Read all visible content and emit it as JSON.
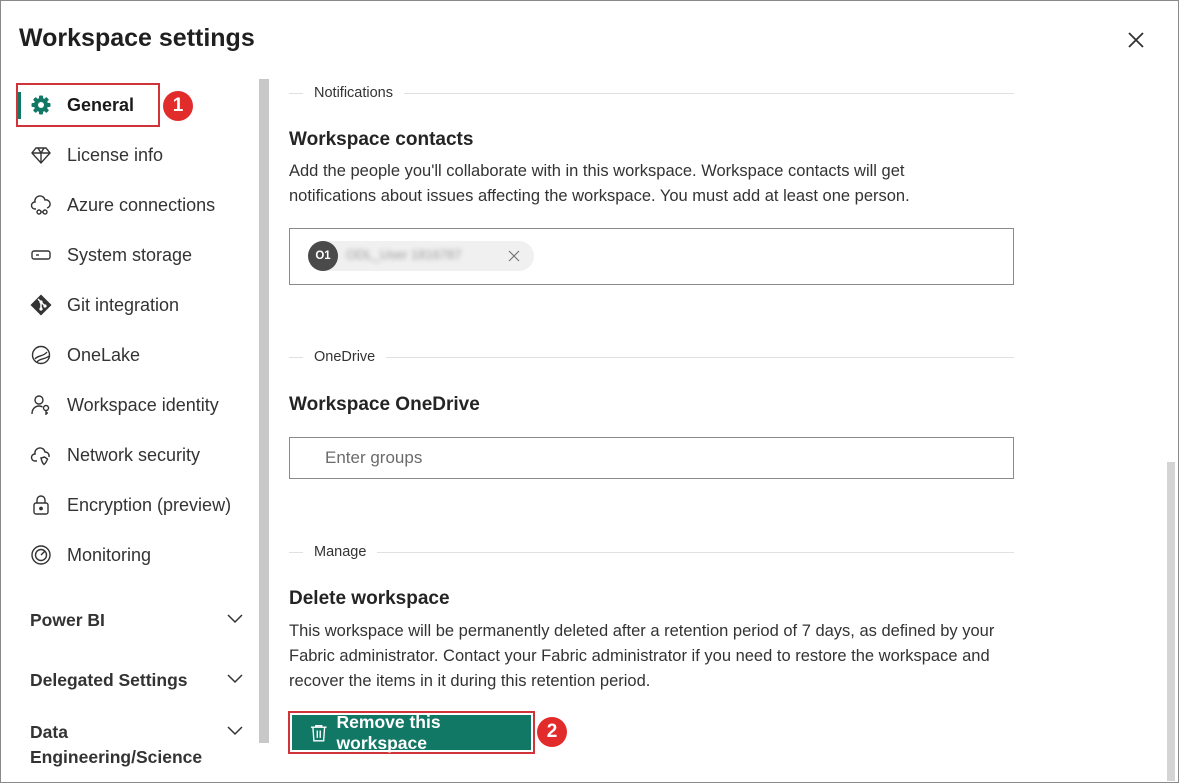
{
  "dialog": {
    "title": "Workspace settings",
    "close_icon": "close-icon"
  },
  "sidebar": {
    "items": [
      {
        "label": "General",
        "icon": "gear-icon",
        "active": true
      },
      {
        "label": "License info",
        "icon": "diamond-icon"
      },
      {
        "label": "Azure connections",
        "icon": "cloud-link-icon"
      },
      {
        "label": "System storage",
        "icon": "storage-icon"
      },
      {
        "label": "Git integration",
        "icon": "git-icon"
      },
      {
        "label": "OneLake",
        "icon": "onelake-icon"
      },
      {
        "label": "Workspace identity",
        "icon": "identity-key-icon"
      },
      {
        "label": "Network security",
        "icon": "cloud-shield-icon"
      },
      {
        "label": "Encryption (preview)",
        "icon": "lock-icon"
      },
      {
        "label": "Monitoring",
        "icon": "gauge-icon"
      }
    ],
    "sections": [
      {
        "label": "Power BI"
      },
      {
        "label": "Delegated Settings"
      },
      {
        "label": "Data Engineering/Science"
      }
    ]
  },
  "annotations": {
    "step1": "1",
    "step2": "2",
    "accent_color": "#117865",
    "highlight_color": "#d13438",
    "badge_color": "#e22b2b"
  },
  "main": {
    "notifications": {
      "divider_label": "Notifications",
      "heading": "Workspace contacts",
      "description": "Add the people you'll collaborate with in this workspace. Workspace contacts will get notifications about issues affecting the workspace. You must add at least one person.",
      "contact": {
        "initials": "O1",
        "name": "ODL_User 1816787"
      }
    },
    "onedrive": {
      "divider_label": "OneDrive",
      "heading": "Workspace OneDrive",
      "placeholder": "Enter groups"
    },
    "manage": {
      "divider_label": "Manage",
      "heading": "Delete workspace",
      "description": "This workspace will be permanently deleted after a retention period of 7 days, as defined by your Fabric administrator. Contact your Fabric administrator if you need to restore the workspace and recover the items in it during this retention period.",
      "remove_label": "Remove this workspace"
    }
  }
}
